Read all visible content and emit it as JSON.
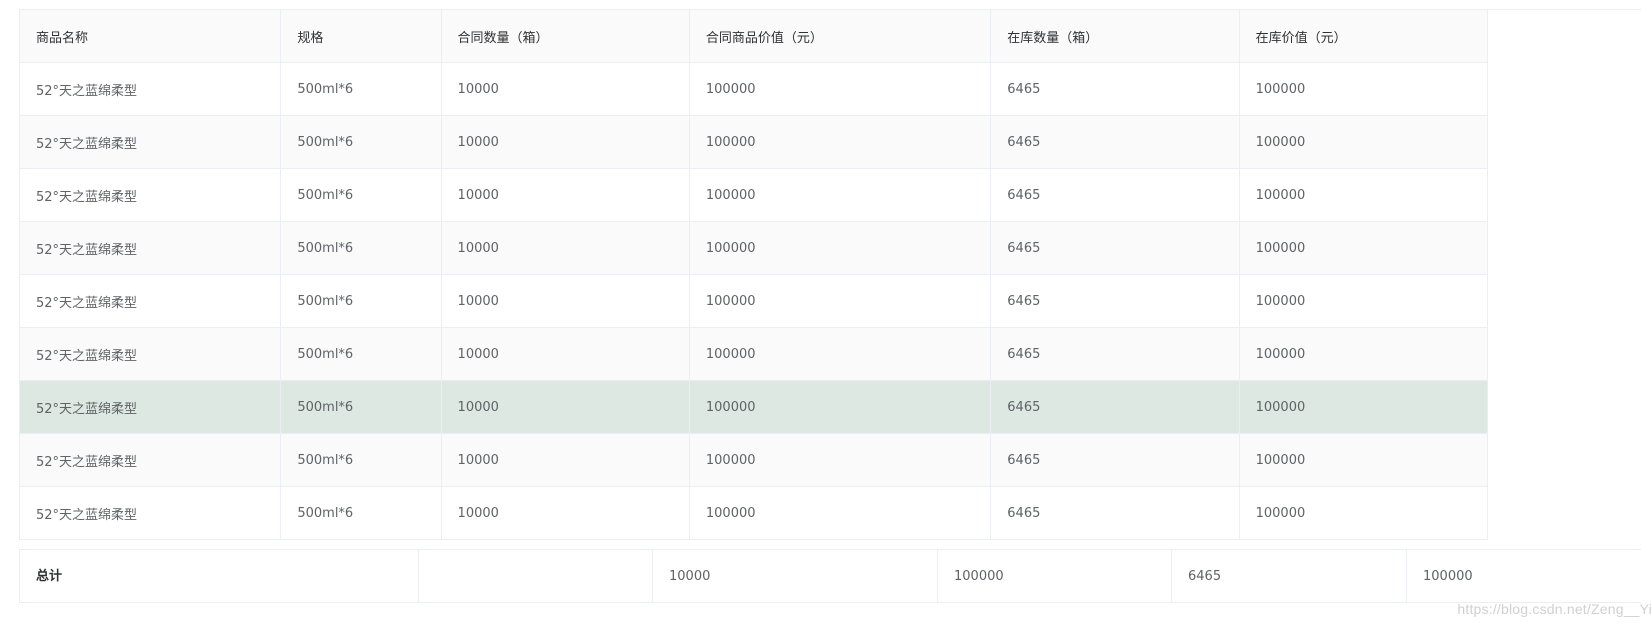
{
  "table": {
    "headers": [
      "商品名称",
      "规格",
      "合同数量（箱）",
      "合同商品价值（元）",
      "在库数量（箱）",
      "在库价值（元）"
    ],
    "rows": [
      [
        "52°天之蓝绵柔型",
        "500ml*6",
        "10000",
        "100000",
        "6465",
        "100000"
      ],
      [
        "52°天之蓝绵柔型",
        "500ml*6",
        "10000",
        "100000",
        "6465",
        "100000"
      ],
      [
        "52°天之蓝绵柔型",
        "500ml*6",
        "10000",
        "100000",
        "6465",
        "100000"
      ],
      [
        "52°天之蓝绵柔型",
        "500ml*6",
        "10000",
        "100000",
        "6465",
        "100000"
      ],
      [
        "52°天之蓝绵柔型",
        "500ml*6",
        "10000",
        "100000",
        "6465",
        "100000"
      ],
      [
        "52°天之蓝绵柔型",
        "500ml*6",
        "10000",
        "100000",
        "6465",
        "100000"
      ],
      [
        "52°天之蓝绵柔型",
        "500ml*6",
        "10000",
        "100000",
        "6465",
        "100000"
      ],
      [
        "52°天之蓝绵柔型",
        "500ml*6",
        "10000",
        "100000",
        "6465",
        "100000"
      ],
      [
        "52°天之蓝绵柔型",
        "500ml*6",
        "10000",
        "100000",
        "6465",
        "100000"
      ]
    ],
    "highlighted_row": 6
  },
  "summary": {
    "label": "总计",
    "blank": "",
    "values": [
      "10000",
      "100000",
      "6465",
      "100000"
    ]
  },
  "watermark": "https://blog.csdn.net/Zeng__Yi",
  "colors": {
    "border": "#ebeef5",
    "header_bg": "#fafafa",
    "highlight_bg": "#dce8e1",
    "text": "#606266"
  }
}
